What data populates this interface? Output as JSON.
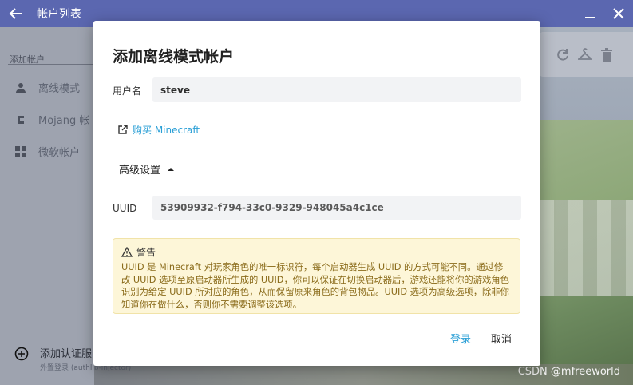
{
  "app": {
    "title": "帐户列表",
    "sidebar": {
      "section_label": "添加帐户",
      "items": [
        {
          "label": "离线模式"
        },
        {
          "label": "Mojang 帐"
        },
        {
          "label": "微软帐户"
        }
      ],
      "add_server": {
        "title": "添加认证服",
        "subtitle": "外置登录 (authlib-injector)"
      }
    }
  },
  "dialog": {
    "title": "添加离线模式帐户",
    "username_label": "用户名",
    "username_value": "steve",
    "buy_link": "购买 Minecraft",
    "advanced_label": "高级设置",
    "uuid_label": "UUID",
    "uuid_value": "53909932-f794-33c0-9329-948045a4c1ce",
    "warning": {
      "title": "警告",
      "text": "UUID 是 Minecraft 对玩家角色的唯一标识符，每个启动器生成 UUID 的方式可能不同。通过修改 UUID 选项至原启动器所生成的 UUID，你可以保证在切换启动器后，游戏还能将你的游戏角色识别为给定 UUID 所对应的角色，从而保留原来角色的背包物品。UUID 选项为高级选项，除非你知道你在做什么，否则你不需要调整该选项。"
    },
    "login_button": "登录",
    "cancel_button": "取消"
  },
  "watermark": "CSDN @mfreeworld",
  "colors": {
    "accent": "#2a9fd6",
    "titlebar": "#5b67b0",
    "warning_bg": "#fdf6d8"
  }
}
